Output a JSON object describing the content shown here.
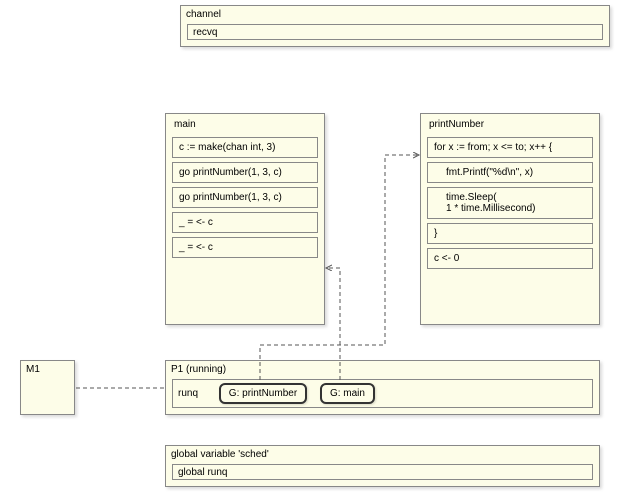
{
  "channel": {
    "title": "channel",
    "queue": "recvq"
  },
  "main": {
    "title": "main",
    "rows": [
      "c := make(chan int, 3)",
      "go printNumber(1, 3, c)",
      "go printNumber(1, 3, c)",
      "_ = <- c",
      "_ = <- c"
    ]
  },
  "printNumber": {
    "title": "printNumber",
    "rows": [
      "for x := from; x <= to; x++ {",
      "fmt.Printf(\"%d\\n\", x)",
      "time.Sleep(\n1 * time.Millisecond)",
      "}",
      "c <- 0"
    ]
  },
  "m1": {
    "title": "M1"
  },
  "p1": {
    "title": "P1 (running)",
    "runq": "runq",
    "g1": "G: printNumber",
    "g2": "G: main"
  },
  "sched": {
    "title": "global variable 'sched'",
    "runq": "global runq"
  }
}
